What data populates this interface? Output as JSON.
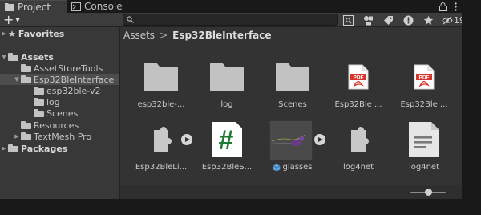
{
  "tabs": [
    {
      "label": "Project",
      "icon": "project-folder-icon",
      "active": true
    },
    {
      "label": "Console",
      "icon": "console-icon",
      "active": false
    }
  ],
  "toolbar": {
    "create_label": "+",
    "search_value": "",
    "hidden_count": "19"
  },
  "tree": {
    "favorites": "Favorites",
    "assets": "Assets",
    "items": [
      {
        "label": "AssetStoreTools"
      },
      {
        "label": "Esp32BleInterface"
      },
      {
        "label": "esp32ble-v2"
      },
      {
        "label": "log"
      },
      {
        "label": "Scenes"
      },
      {
        "label": "Resources"
      },
      {
        "label": "TextMesh Pro"
      }
    ],
    "packages": "Packages"
  },
  "breadcrumb": {
    "root": "Assets",
    "separator": ">",
    "current": "Esp32BleInterface"
  },
  "grid": {
    "items": [
      {
        "label": "esp32ble-...",
        "kind": "folder-icon"
      },
      {
        "label": "log",
        "kind": "folder-icon"
      },
      {
        "label": "Scenes",
        "kind": "folder-icon"
      },
      {
        "label": "Esp32Ble ...",
        "kind": "pdf-icon"
      },
      {
        "label": "Esp32Ble ...",
        "kind": "pdf-icon"
      },
      {
        "label": "Esp32BleLi...",
        "kind": "plugin-icon"
      },
      {
        "label": "Esp32BleS...",
        "kind": "csharp-script-icon"
      },
      {
        "label": "glasses",
        "kind": "model-prefab"
      },
      {
        "label": "log4net",
        "kind": "plugin-icon"
      },
      {
        "label": "log4net",
        "kind": "text-document-icon"
      }
    ],
    "pdf_badge": "PDF",
    "script_glyph": "#"
  },
  "colors": {
    "panel": "#333333",
    "tree": "#383838",
    "pdf_red": "#d9342b",
    "script_green": "#1d7a33",
    "accent_blue": "#5fa2dd"
  },
  "zoom_slider": 0.5
}
